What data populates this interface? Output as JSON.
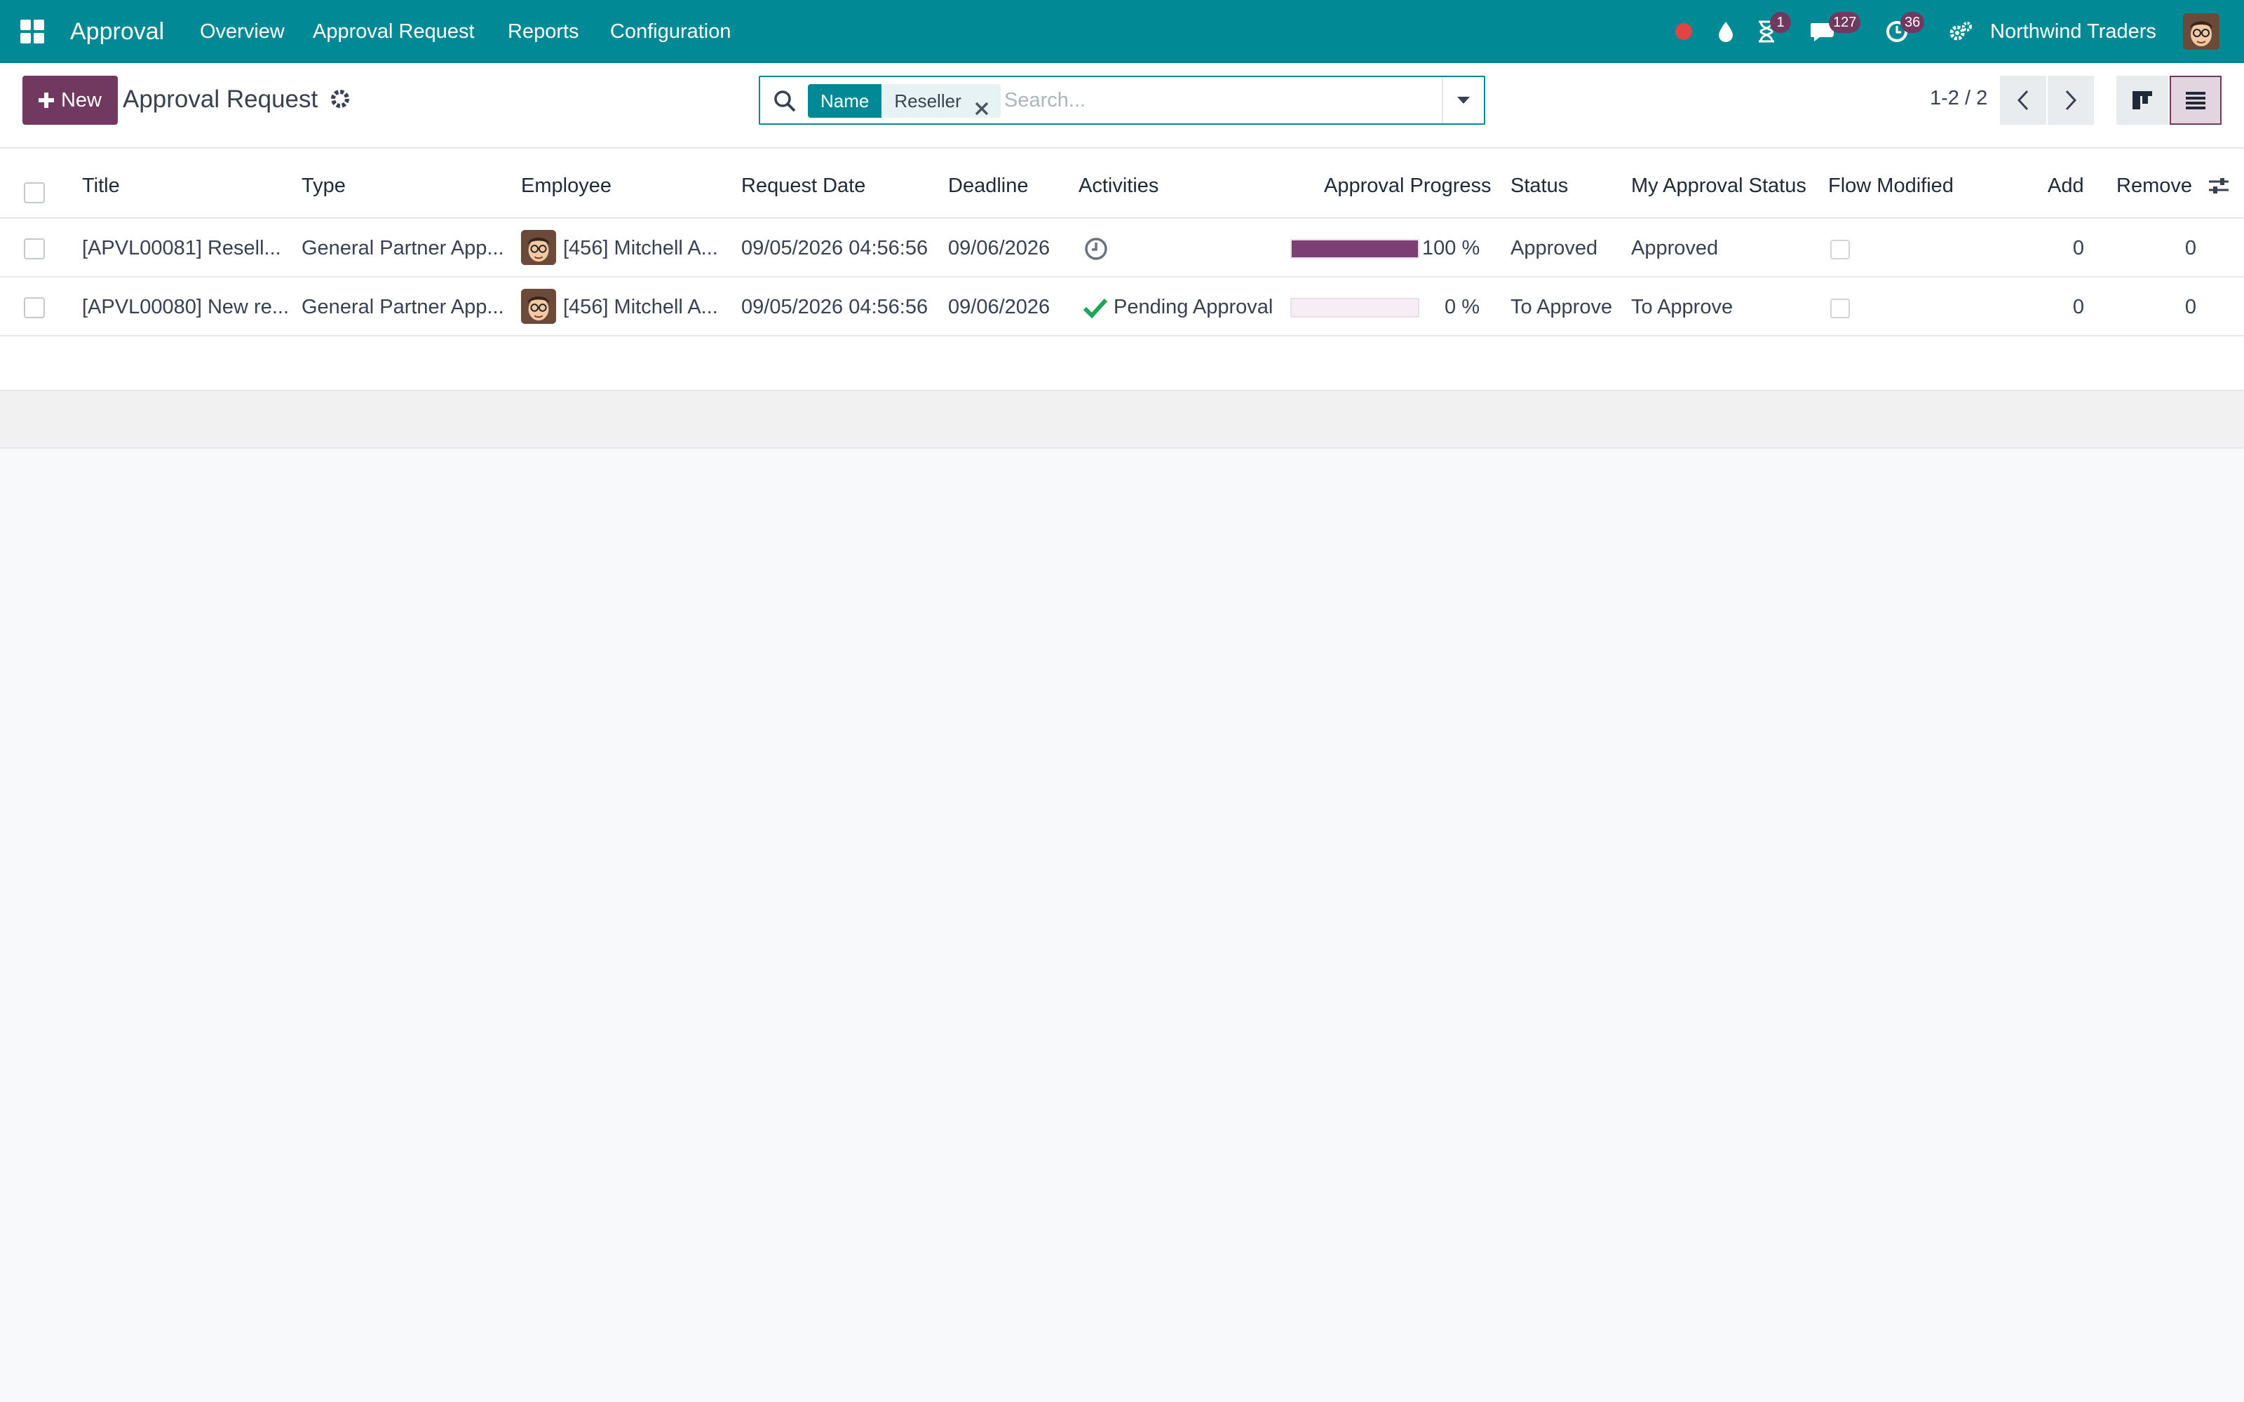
{
  "navbar": {
    "brand": "Approval",
    "menu": [
      "Overview",
      "Approval Request",
      "Reports",
      "Configuration"
    ],
    "badges": {
      "activities_timer": "1",
      "messages": "127",
      "clock": "36"
    },
    "company": "Northwind Traders",
    "brand_color": "#018a96"
  },
  "control_panel": {
    "new_label": "New",
    "breadcrumb": "Approval Request",
    "search": {
      "facet_name": "Name",
      "facet_value": "Reseller",
      "placeholder": "Search..."
    },
    "pager": "1-2 / 2",
    "accent_color": "#71395f"
  },
  "list": {
    "columns": [
      "Title",
      "Type",
      "Employee",
      "Request Date",
      "Deadline",
      "Activities",
      "Approval Progress",
      "Status",
      "My Approval Status",
      "Flow Modified",
      "Add",
      "Remove"
    ],
    "rows": [
      {
        "title": "[APVL00081] Resell...",
        "type": "General Partner App...",
        "employee": "[456] Mitchell A...",
        "request_date": "09/05/2026 04:56:56",
        "deadline": "09/06/2026",
        "activity": "",
        "activity_icon": "clock-icon",
        "progress": 100,
        "progress_label": "100 %",
        "status": "Approved",
        "my_status": "Approved",
        "add": "0",
        "remove": "0"
      },
      {
        "title": "[APVL00080] New re...",
        "type": "General Partner App...",
        "employee": "[456] Mitchell A...",
        "request_date": "09/05/2026 04:56:56",
        "deadline": "09/06/2026",
        "activity": "Pending Approval",
        "activity_icon": "check-icon",
        "progress": 0,
        "progress_label": "0 %",
        "status": "To Approve",
        "my_status": "To Approve",
        "add": "0",
        "remove": "0"
      }
    ]
  }
}
